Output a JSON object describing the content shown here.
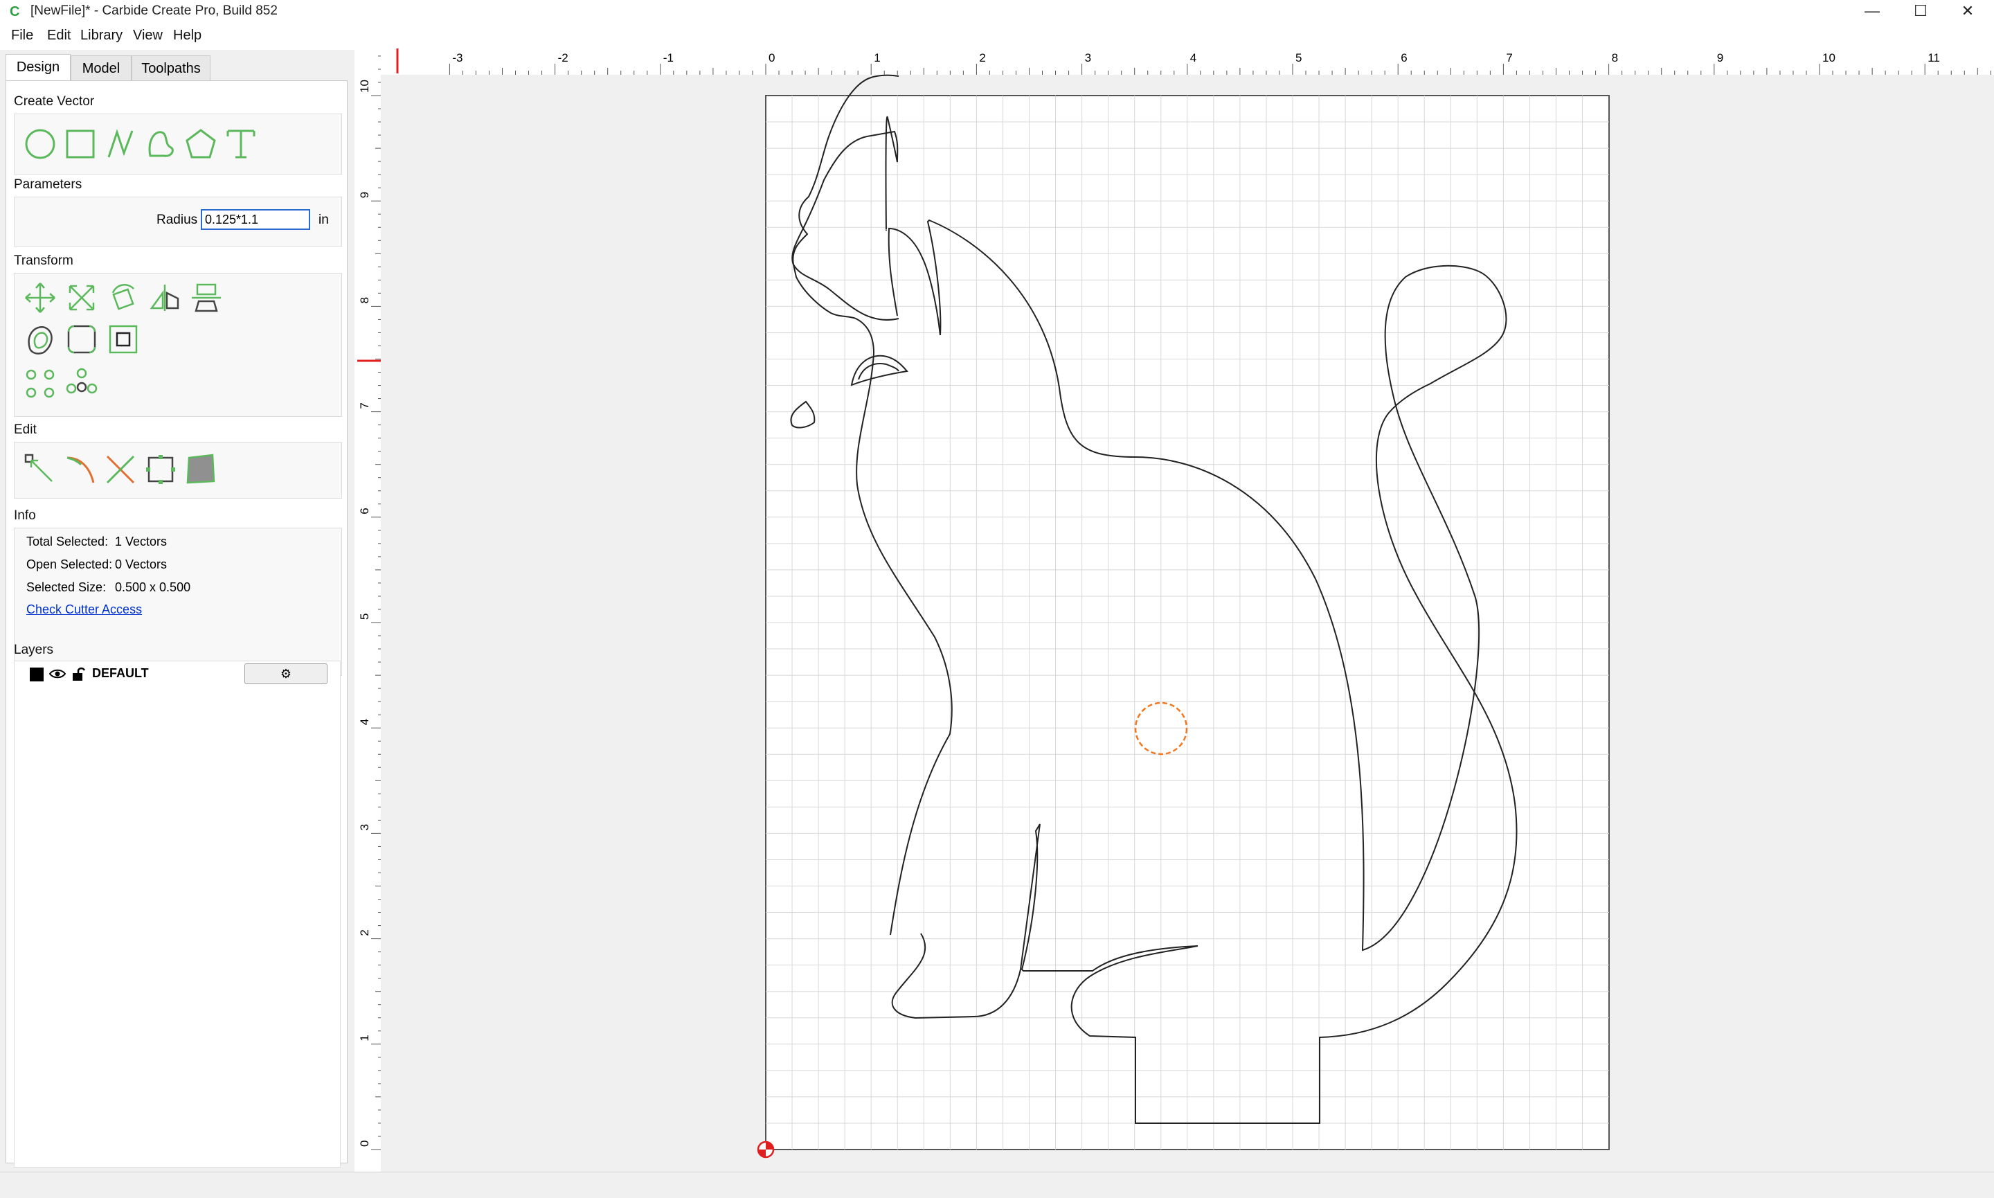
{
  "window": {
    "title": "[NewFile]* - Carbide Create Pro, Build 852",
    "minimize_icon": "minimize-icon",
    "maximize_icon": "maximize-icon",
    "close_icon": "close-icon"
  },
  "menu": [
    {
      "label": "File",
      "mnemonic": "F"
    },
    {
      "label": "Edit",
      "mnemonic": "E"
    },
    {
      "label": "Library",
      "mnemonic": ""
    },
    {
      "label": "View",
      "mnemonic": ""
    },
    {
      "label": "Help",
      "mnemonic": "H"
    }
  ],
  "tabs": [
    {
      "label": "Design",
      "active": true
    },
    {
      "label": "Model",
      "active": false
    },
    {
      "label": "Toolpaths",
      "active": false
    }
  ],
  "sections": {
    "create_vector": "Create Vector",
    "parameters": "Parameters",
    "transform": "Transform",
    "edit": "Edit",
    "info": "Info",
    "layers": "Layers"
  },
  "create_vector_tools": [
    "circle-tool-icon",
    "rectangle-tool-icon",
    "polyline-tool-icon",
    "curve-tool-icon",
    "polygon-tool-icon",
    "text-tool-icon"
  ],
  "parameters": {
    "radius_label": "Radius",
    "radius_value": "0.125*1.1",
    "unit": "in"
  },
  "transform_tools": [
    "move-icon",
    "scale-icon",
    "rotate-icon",
    "mirror-icon",
    "align-icon",
    "offset-icon",
    "fillet-icon",
    "boolean-icon",
    "array-grid-icon",
    "array-circle-icon"
  ],
  "edit_tools": [
    "node-edit-icon",
    "trim-icon",
    "cut-icon",
    "box-select-icon",
    "pocket-icon"
  ],
  "info": {
    "total_selected_label": "Total Selected:",
    "total_selected_value": "1 Vectors",
    "open_selected_label": "Open Selected:",
    "open_selected_value": "0 Vectors",
    "selected_size_label": "Selected Size:",
    "selected_size_value": "0.500 x 0.500",
    "check_access": "Check Cutter Access"
  },
  "layers": [
    {
      "name": "DEFAULT",
      "color": "#000000",
      "visible_icon": "eye-icon",
      "lock_icon": "unlock-icon",
      "settings_icon": "gear-icon"
    }
  ],
  "add_layer_label": "+",
  "ruler": {
    "x_ticks": [
      "-3",
      "-2",
      "-1",
      "0",
      "1",
      "2",
      "3",
      "4",
      "5",
      "6",
      "7",
      "8",
      "9",
      "10",
      "11"
    ],
    "y_ticks": [
      "0",
      "1",
      "2",
      "3",
      "4",
      "5",
      "6",
      "7",
      "8",
      "9",
      "10"
    ]
  },
  "colors": {
    "accent": "#2a6ad0",
    "tool_green": "#5cb85c",
    "selection": "#f07820",
    "origin": "#e02020",
    "grid": "#d8d8d8"
  }
}
